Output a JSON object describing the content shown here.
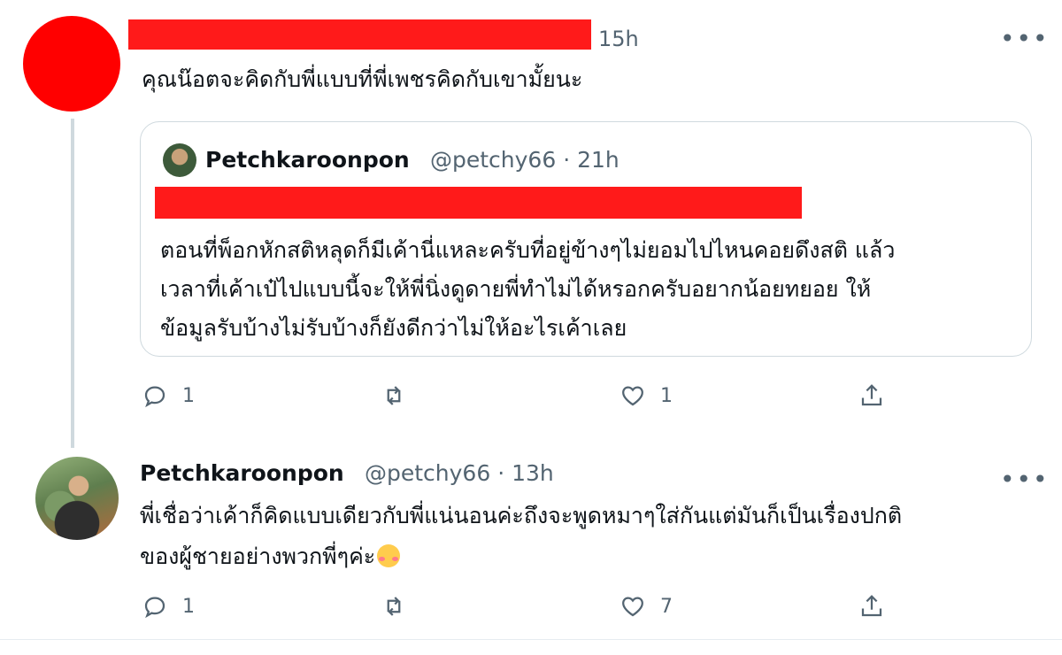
{
  "tweet1": {
    "time": "15h",
    "text": "คุณน๊อตจะคิดกับพี่แบบที่พี่เพชรคิดกับเขามั้ยนะ",
    "more": "•••",
    "quote": {
      "name": "Petchkaroonpon",
      "handle": "@petchy66 · 21h",
      "lines": [
        "ตอนที่พ็อกหักสติหลุดก็มีเค้านี่แหละครับที่อยู่ข้างๆไม่ยอมไปไหนคอยดึงสติ แล้ว",
        "เวลาที่เค้าเป๋ไปแบบนี้จะให้พี่นิ่งดูดายพี่ทำไม่ได้หรอกครับอยากน้อยทยอย ให้",
        "ข้อมูลรับบ้างไม่รับบ้างก็ยังดีกว่าไม่ให้อะไรเค้าเลย"
      ]
    },
    "actions": {
      "replies": "1",
      "retweets": "",
      "likes": "1"
    }
  },
  "tweet2": {
    "name": "Petchkaroonpon",
    "handle": "@petchy66 · 13h",
    "more": "•••",
    "lines": [
      "พี่เชื่อว่าเค้าก็คิดแบบเดียวกับพี่แน่นอนค่ะถึงจะพูดหมาๆใส่กันแต่มันก็เป็นเรื่องปกติ",
      "ของผู้ชายอย่างพวกพี่ๆค่ะ"
    ],
    "actions": {
      "replies": "1",
      "retweets": "",
      "likes": "7"
    }
  },
  "icons": [
    "reply-icon",
    "retweet-icon",
    "like-icon",
    "share-icon",
    "more-icon",
    "blush-emoji-icon"
  ],
  "colors": {
    "redaction": "#ff1a1a",
    "muted": "#536471",
    "border": "#cfd9de"
  }
}
